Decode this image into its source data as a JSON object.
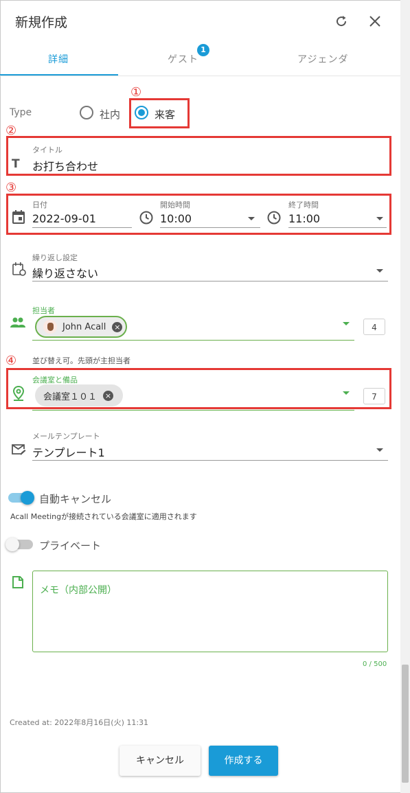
{
  "header": {
    "title": "新規作成",
    "refresh_icon": "refresh-icon",
    "close_icon": "close-icon"
  },
  "tabs": [
    {
      "label": "詳細",
      "active": true
    },
    {
      "label": "ゲスト",
      "badge": "1"
    },
    {
      "label": "アジェンダ"
    }
  ],
  "annotations": [
    "①",
    "②",
    "③",
    "④"
  ],
  "type": {
    "label": "Type",
    "options": [
      "社内",
      "来客"
    ],
    "selected": "来客"
  },
  "title_field": {
    "label": "タイトル",
    "value": "お打ち合わせ"
  },
  "date": {
    "label": "日付",
    "value": "2022-09-01"
  },
  "start": {
    "label": "開始時間",
    "value": "10:00"
  },
  "end": {
    "label": "終了時間",
    "value": "11:00"
  },
  "repeat": {
    "label": "繰り返し設定",
    "value": "繰り返さない"
  },
  "host": {
    "label": "担当者",
    "chip": "John Acall",
    "count": "4"
  },
  "host_hint": "並び替え可。先頭が主担当者",
  "room": {
    "label": "会議室と備品",
    "chip": "会議室１０１",
    "count": "7"
  },
  "mail": {
    "label": "メールテンプレート",
    "value": "テンプレート1"
  },
  "auto_cancel": {
    "label": "自動キャンセル",
    "on": true,
    "hint": "Acall Meetingが接続されている会議室に適用されます"
  },
  "private": {
    "label": "プライベート",
    "on": false
  },
  "memo": {
    "placeholder": "メモ（内部公開）",
    "counter": "0 / 500"
  },
  "created_at": "Created at: 2022年8月16日(火) 11:31",
  "footer": {
    "cancel": "キャンセル",
    "create": "作成する"
  },
  "colors": {
    "accent": "#1a9bd7",
    "green": "#4caf50",
    "annotation": "#e53935"
  }
}
